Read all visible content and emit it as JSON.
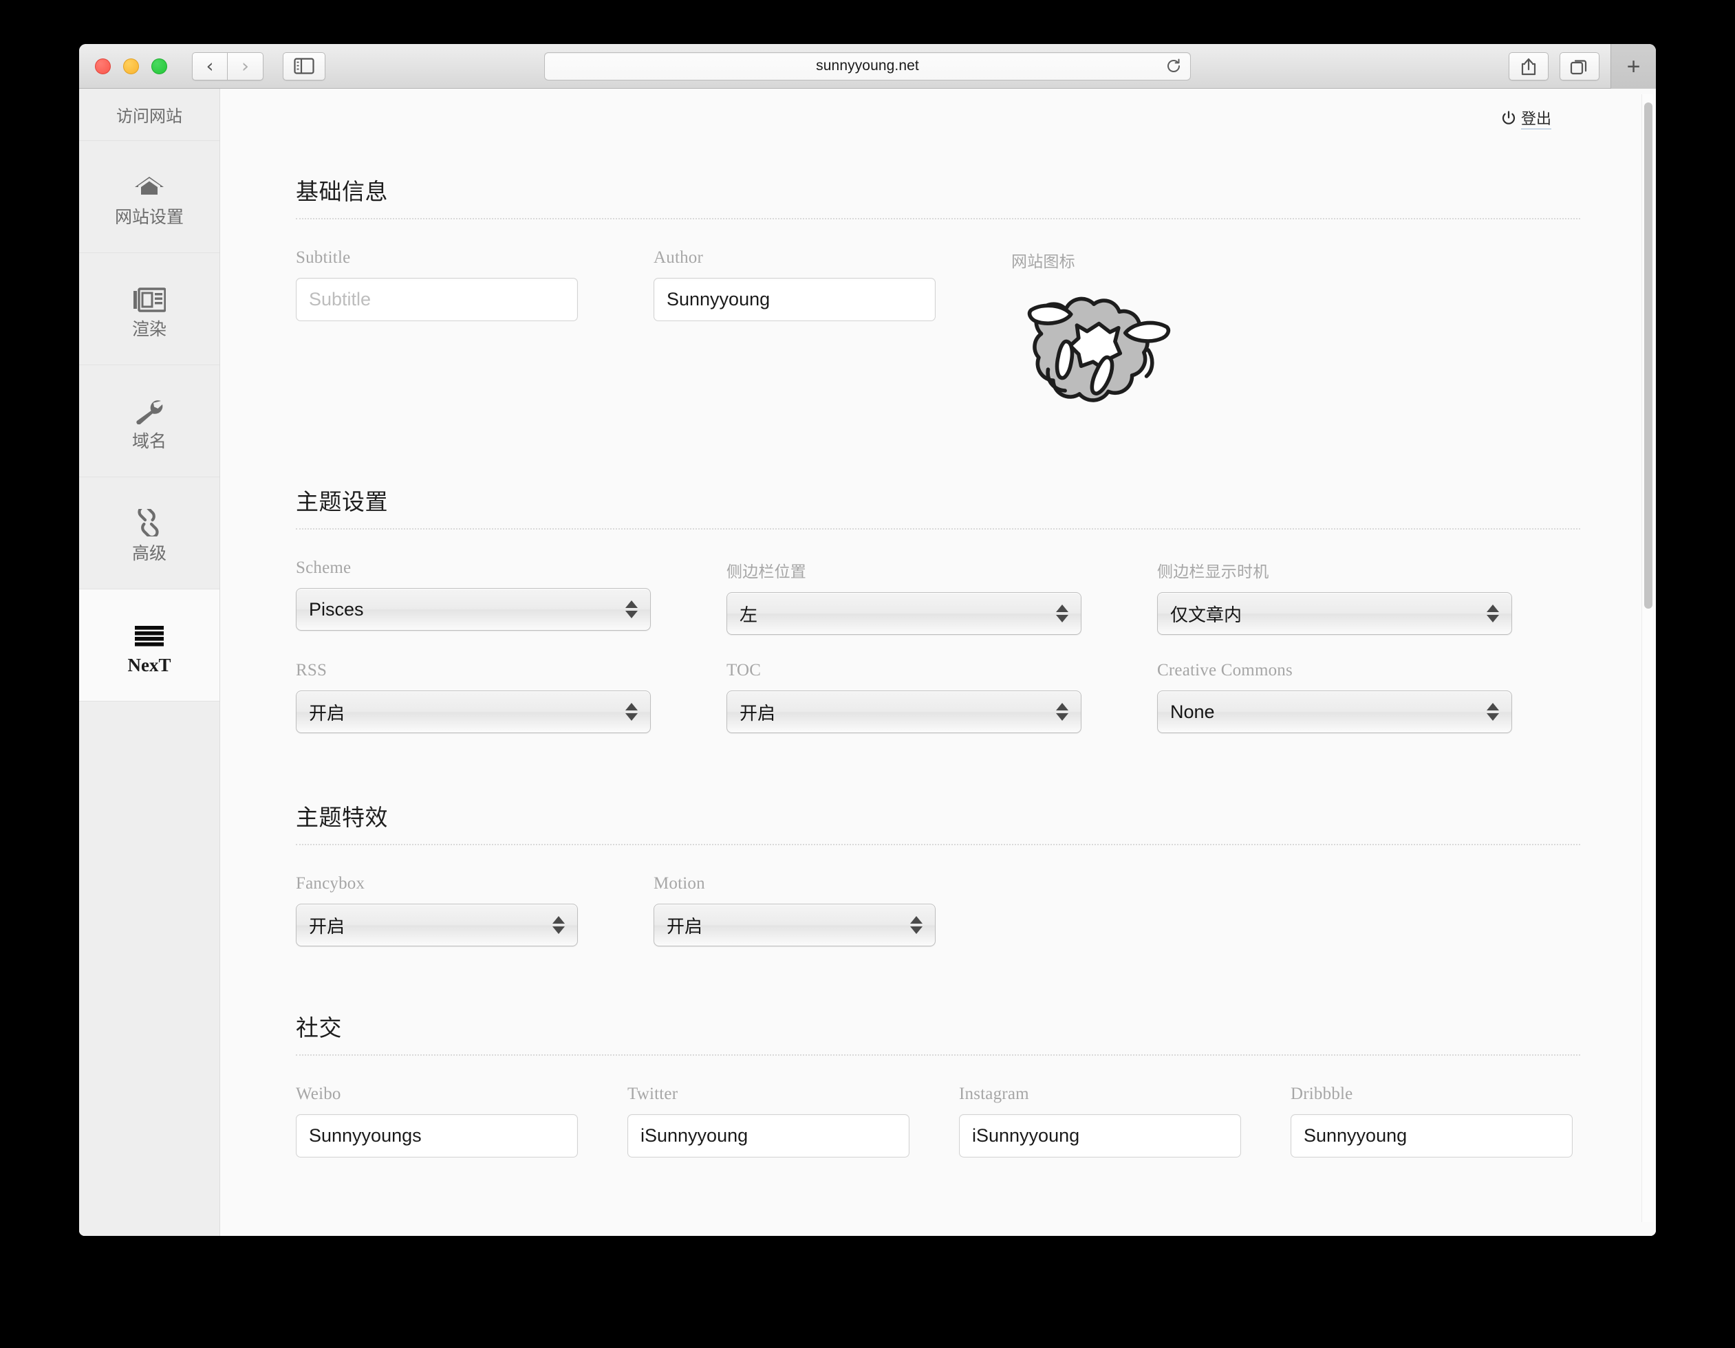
{
  "browser": {
    "url": "sunnyyoung.net",
    "back_icon": "chevron-left-icon",
    "forward_icon": "chevron-right-icon",
    "sidebar_icon": "sidebar-toggle-icon",
    "reload_icon": "reload-icon",
    "share_icon": "share-icon",
    "tabs_icon": "tab-overview-icon",
    "new_tab_label": "+"
  },
  "sidebar": {
    "visit_site": "访问网站",
    "items": [
      {
        "label": "网站设置",
        "icon": "home-icon",
        "active": false
      },
      {
        "label": "渲染",
        "icon": "newspaper-icon",
        "active": false
      },
      {
        "label": "域名",
        "icon": "wrench-icon",
        "active": false
      },
      {
        "label": "高级",
        "icon": "link-icon",
        "active": false
      },
      {
        "label": "NexT",
        "icon": "hamburger-icon",
        "active": true
      }
    ]
  },
  "header": {
    "logout_label": "登出",
    "logout_icon": "power-icon"
  },
  "sections": {
    "basic": {
      "title": "基础信息",
      "subtitle": {
        "label": "Subtitle",
        "value": "",
        "placeholder": "Subtitle"
      },
      "author": {
        "label": "Author",
        "value": "Sunnyyoung"
      },
      "site_icon_label": "网站图标",
      "site_icon_name": "sheep-logo"
    },
    "theme": {
      "title": "主题设置",
      "fields": [
        {
          "label": "Scheme",
          "value": "Pisces",
          "cjk": false
        },
        {
          "label": "侧边栏位置",
          "value": "左",
          "cjk": true
        },
        {
          "label": "侧边栏显示时机",
          "value": "仅文章内",
          "cjk": true
        },
        {
          "label": "RSS",
          "value": "开启",
          "cjk": true
        },
        {
          "label": "TOC",
          "value": "开启",
          "cjk": true
        },
        {
          "label": "Creative Commons",
          "value": "None",
          "cjk": false
        }
      ]
    },
    "effects": {
      "title": "主题特效",
      "fields": [
        {
          "label": "Fancybox",
          "value": "开启"
        },
        {
          "label": "Motion",
          "value": "开启"
        }
      ]
    },
    "social": {
      "title": "社交",
      "fields": [
        {
          "label": "Weibo",
          "value": "Sunnyyoungs"
        },
        {
          "label": "Twitter",
          "value": "iSunnyyoung"
        },
        {
          "label": "Instagram",
          "value": "iSunnyyoung"
        },
        {
          "label": "Dribbble",
          "value": "Sunnyyoung"
        }
      ]
    }
  },
  "colors": {
    "accent_link": "#9bb7d4",
    "label_gray": "#a6a6a6",
    "sidebar_bg": "#eeeeee",
    "content_bg": "#fafafa"
  }
}
